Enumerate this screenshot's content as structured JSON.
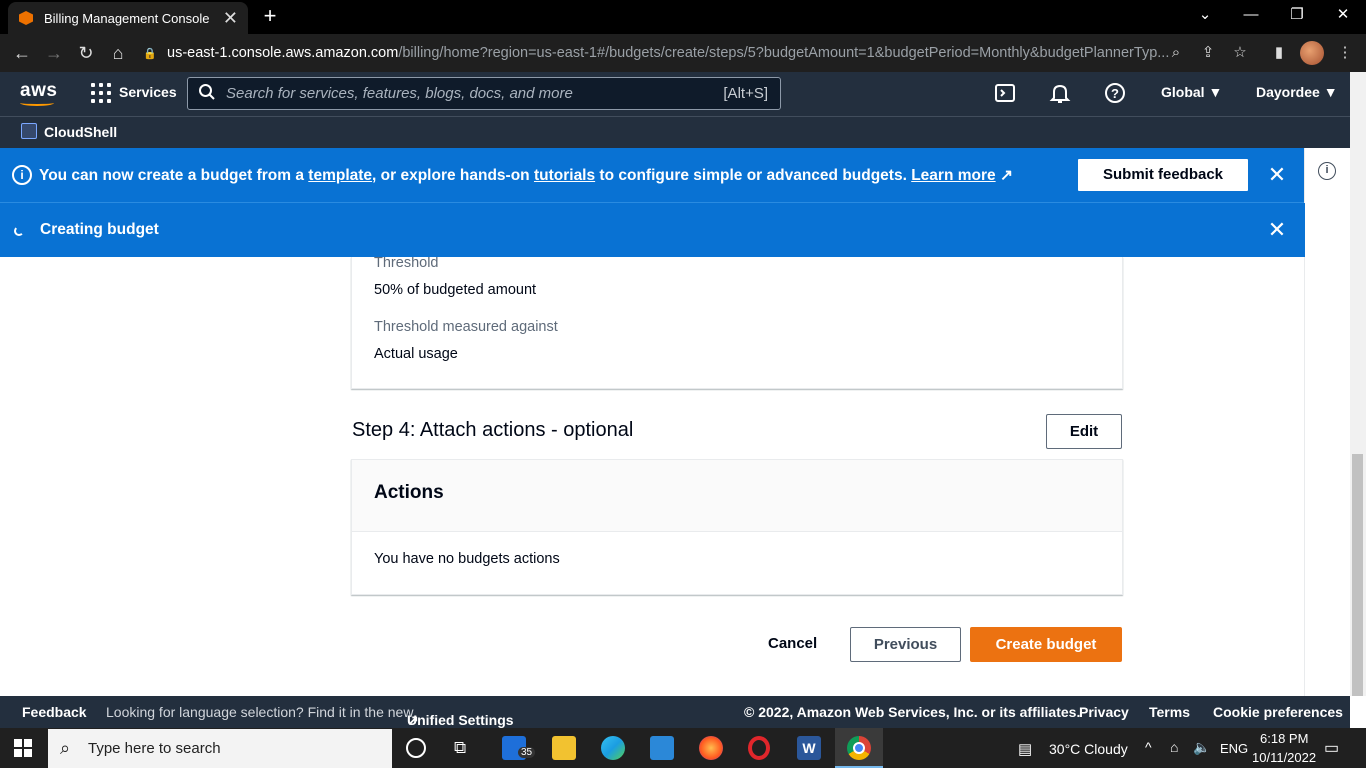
{
  "browser": {
    "tab_title": "Billing Management Console",
    "url_host": "us-east-1.console.aws.amazon.com",
    "url_path": "/billing/home?region=us-east-1#/budgets/create/steps/5?budgetAmount=1&budgetPeriod=Monthly&budgetPlannerTyp..."
  },
  "aws_header": {
    "logo": "aws",
    "services_label": "Services",
    "search_placeholder": "Search for services, features, blogs, docs, and more",
    "search_shortcut": "[Alt+S]",
    "region": "Global",
    "user": "Dayordee",
    "cloudshell_label": "CloudShell"
  },
  "flash_info": {
    "text_1": "You can now create a budget from a ",
    "link_template": "template",
    "text_2": ", or explore hands-on ",
    "link_tutorials": "tutorials",
    "text_3": " to configure simple or advanced budgets. ",
    "link_learn_more": "Learn more",
    "feedback_button": "Submit feedback"
  },
  "flash_progress": {
    "text": "Creating budget"
  },
  "threshold_card": {
    "threshold_label": "Threshold",
    "threshold_value": "50% of budgeted amount",
    "measured_label": "Threshold measured against",
    "measured_value": "Actual usage"
  },
  "step4": {
    "title": "Step 4: Attach actions - optional",
    "edit_button": "Edit",
    "card_title": "Actions",
    "empty_text": "You have no budgets actions"
  },
  "wizard_buttons": {
    "cancel": "Cancel",
    "previous": "Previous",
    "create": "Create budget"
  },
  "footer": {
    "feedback": "Feedback",
    "language_text": "Looking for language selection? Find it in the new",
    "unified_settings": "Unified Settings",
    "copyright": "© 2022, Amazon Web Services, Inc. or its affiliates.",
    "privacy": "Privacy",
    "terms": "Terms",
    "cookie": "Cookie preferences"
  },
  "taskbar": {
    "search_placeholder": "Type here to search",
    "mail_badge": "35",
    "weather": "30°C  Cloudy",
    "lang": "ENG",
    "time": "6:18 PM",
    "date": "10/11/2022"
  },
  "colors": {
    "aws_dark": "#232f3e",
    "flash_blue": "#0972d3",
    "primary_orange": "#ec7211"
  }
}
